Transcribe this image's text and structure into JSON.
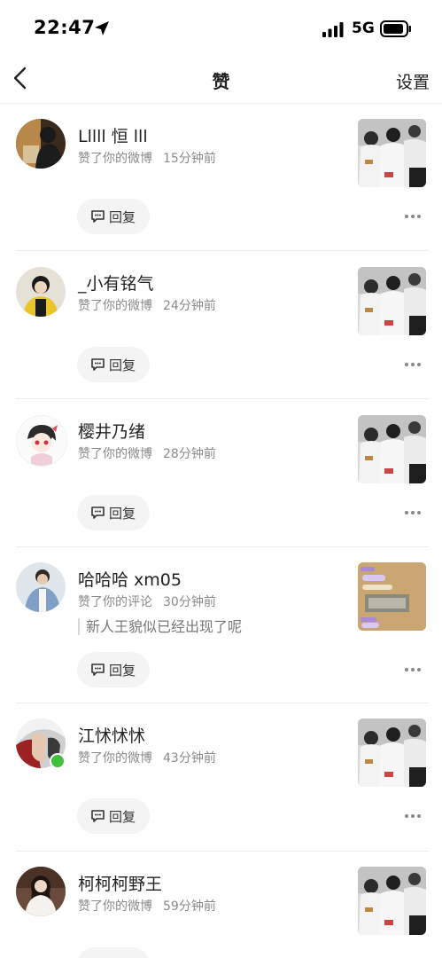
{
  "status_bar": {
    "time": "22:47",
    "network": "5G"
  },
  "nav": {
    "title": "赞",
    "settings_label": "设置"
  },
  "likes": [
    {
      "name": "Lllll 恒 lll",
      "action": "赞了你的微博",
      "time": "15分钟前",
      "reply_label": "回复",
      "avatar": "avatar-dark-room",
      "thumbnail": "post-photo-group",
      "comment": "",
      "online": false
    },
    {
      "name": "_小有铭气",
      "action": "赞了你的微博",
      "time": "24分钟前",
      "reply_label": "回复",
      "avatar": "avatar-boy-yellow-jacket",
      "thumbnail": "post-photo-group",
      "comment": "",
      "online": false
    },
    {
      "name": "樱井乃绪",
      "action": "赞了你的微博",
      "time": "28分钟前",
      "reply_label": "回复",
      "avatar": "avatar-anime-character",
      "thumbnail": "post-photo-group",
      "comment": "",
      "online": false
    },
    {
      "name": "哈哈哈 xm05",
      "action": "赞了你的评论",
      "time": "30分钟前",
      "reply_label": "回复",
      "avatar": "avatar-denim-jacket",
      "thumbnail": "post-screenshot-chat",
      "comment": "新人王貌似已经出现了呢",
      "online": false
    },
    {
      "name": "江怵怵怵",
      "action": "赞了你的微博",
      "time": "43分钟前",
      "reply_label": "回复",
      "avatar": "avatar-hand-fur-hood",
      "thumbnail": "post-photo-group",
      "comment": "",
      "online": true
    },
    {
      "name": "柯柯柯野王",
      "action": "赞了你的微博",
      "time": "59分钟前",
      "reply_label": "回复",
      "avatar": "avatar-girl-white-sweater",
      "thumbnail": "post-photo-group",
      "comment": "",
      "online": false
    }
  ],
  "colors": {
    "online_dot": "#3fc13b",
    "divider": "#ececec",
    "secondary_text": "#8a8a8a",
    "reply_button_bg": "#f4f4f4"
  },
  "icons": {
    "back": "chevron-left-icon",
    "location": "location-arrow-icon",
    "signal": "cellular-signal-icon",
    "battery": "battery-icon",
    "reply": "comment-bubble-icon",
    "more": "more-dots-icon"
  }
}
